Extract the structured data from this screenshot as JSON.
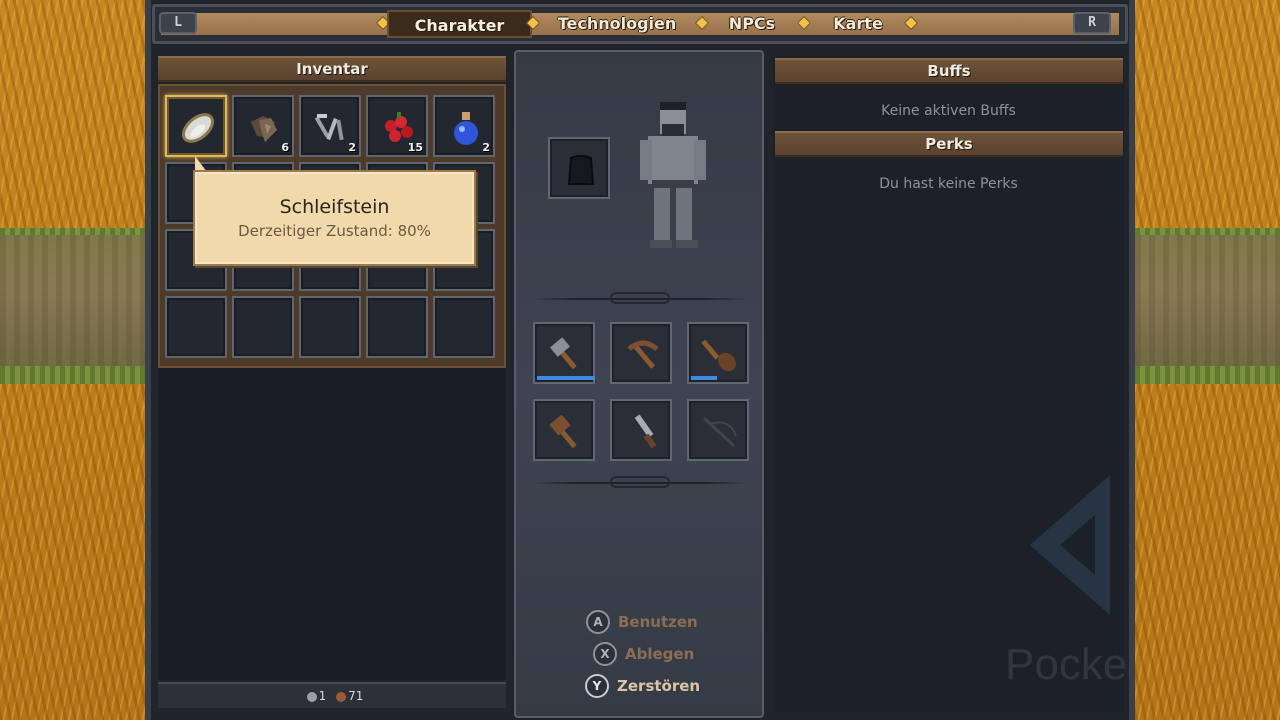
{
  "tabs": {
    "left_shoulder": "L",
    "right_shoulder": "R",
    "items": [
      "Charakter",
      "Technologien",
      "NPCs",
      "Karte"
    ],
    "active": "Charakter"
  },
  "inventory": {
    "title": "Inventar",
    "slots": [
      {
        "icon": "whetstone-icon",
        "count": ""
      },
      {
        "icon": "iron-ore-icon",
        "count": "6"
      },
      {
        "icon": "nails-icon",
        "count": "2"
      },
      {
        "icon": "berries-icon",
        "count": "15"
      },
      {
        "icon": "blue-potion-icon",
        "count": "2"
      }
    ],
    "currency": {
      "silver": "1",
      "copper": "71"
    }
  },
  "tooltip": {
    "title": "Schleifstein",
    "subtitle": "Derzeitiger Zustand: 80%"
  },
  "character": {
    "armor_slot_icon": "shirt-icon",
    "tools": [
      {
        "icon": "hammer-axe-icon",
        "durability": 1.0
      },
      {
        "icon": "pickaxe-icon",
        "durability": null
      },
      {
        "icon": "shovel-icon",
        "durability": 0.42
      },
      {
        "icon": "mallet-icon",
        "durability": null
      },
      {
        "icon": "knife-icon",
        "durability": null
      },
      {
        "icon": "fishing-rod-icon",
        "durability": null
      }
    ]
  },
  "actions": {
    "use": {
      "button": "A",
      "label": "Benutzen"
    },
    "drop": {
      "button": "X",
      "label": "Ablegen"
    },
    "destroy": {
      "button": "Y",
      "label": "Zerstören"
    }
  },
  "buffs": {
    "title": "Buffs",
    "empty_text": "Keine aktiven Buffs"
  },
  "perks": {
    "title": "Perks",
    "empty_text": "Du hast keine Perks"
  },
  "watermark": "Pocke",
  "colors": {
    "accent_gold": "#d9b860",
    "durability_blue": "#3c8be0",
    "header_brown": "#6e5339"
  }
}
